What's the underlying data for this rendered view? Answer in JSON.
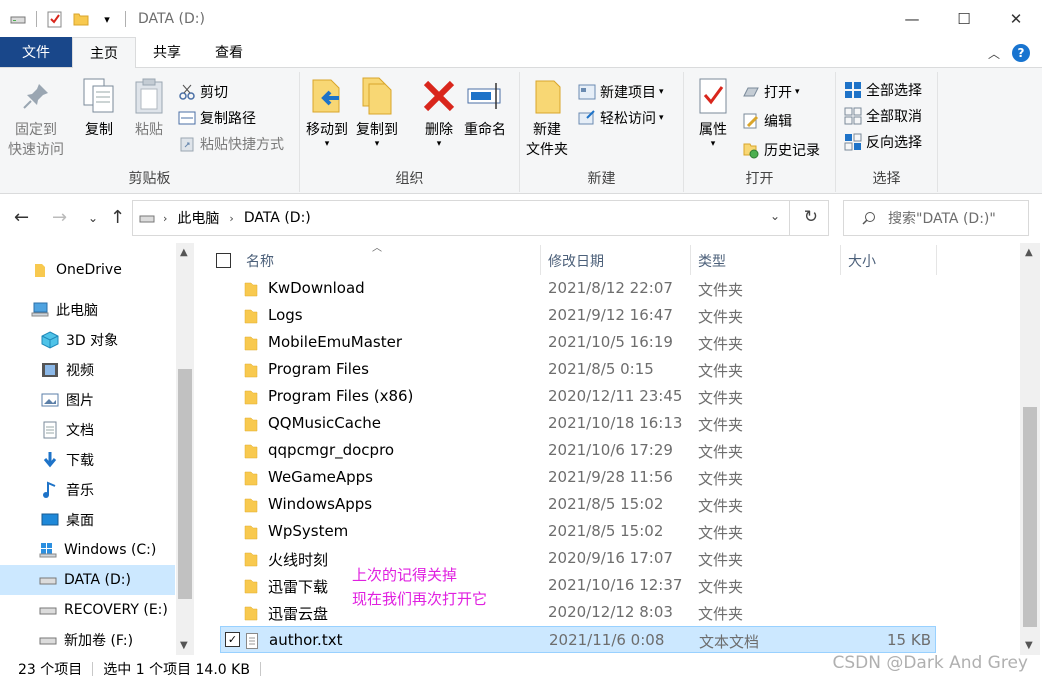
{
  "window": {
    "title": "DATA (D:)",
    "minimize": "—",
    "maximize": "☐",
    "close": "✕"
  },
  "ribbon_tabs": {
    "file": "文件",
    "home": "主页",
    "share": "共享",
    "view": "查看"
  },
  "ribbon": {
    "clipboard": {
      "label": "剪贴板",
      "pin_line1": "固定到",
      "pin_line2": "快速访问",
      "copy": "复制",
      "paste": "粘贴",
      "cut": "剪切",
      "copy_path": "复制路径",
      "paste_shortcut": "粘贴快捷方式"
    },
    "organize": {
      "label": "组织",
      "move_to": "移动到",
      "copy_to": "复制到",
      "delete": "删除",
      "rename": "重命名"
    },
    "new": {
      "label": "新建",
      "new_folder_line1": "新建",
      "new_folder_line2": "文件夹",
      "new_item": "新建项目",
      "easy_access": "轻松访问"
    },
    "open": {
      "label": "打开",
      "properties": "属性",
      "open": "打开",
      "edit": "编辑",
      "history": "历史记录"
    },
    "select": {
      "label": "选择",
      "select_all": "全部选择",
      "select_none": "全部取消",
      "invert": "反向选择"
    }
  },
  "address": {
    "crumb1": "此电脑",
    "crumb2": "DATA (D:)",
    "search_placeholder": "搜索\"DATA (D:)\""
  },
  "nav": {
    "items": [
      {
        "label": "OneDrive",
        "icon": "folder-icon"
      },
      {
        "label": "此电脑",
        "icon": "computer-icon"
      },
      {
        "label": "3D 对象",
        "icon": "cube-icon"
      },
      {
        "label": "视频",
        "icon": "video-icon"
      },
      {
        "label": "图片",
        "icon": "picture-icon"
      },
      {
        "label": "文档",
        "icon": "document-icon"
      },
      {
        "label": "下载",
        "icon": "download-icon"
      },
      {
        "label": "音乐",
        "icon": "music-icon"
      },
      {
        "label": "桌面",
        "icon": "desktop-icon"
      },
      {
        "label": "Windows (C:)",
        "icon": "windows-drive-icon"
      },
      {
        "label": "DATA (D:)",
        "icon": "drive-icon"
      },
      {
        "label": "RECOVERY (E:)",
        "icon": "drive-icon"
      },
      {
        "label": "新加卷 (F:)",
        "icon": "drive-icon"
      }
    ]
  },
  "columns": {
    "name": "名称",
    "date": "修改日期",
    "type": "类型",
    "size": "大小"
  },
  "files": [
    {
      "name": "KwDownload",
      "date": "2021/8/12 22:07",
      "type": "文件夹",
      "size": ""
    },
    {
      "name": "Logs",
      "date": "2021/9/12 16:47",
      "type": "文件夹",
      "size": ""
    },
    {
      "name": "MobileEmuMaster",
      "date": "2021/10/5 16:19",
      "type": "文件夹",
      "size": ""
    },
    {
      "name": "Program Files",
      "date": "2021/8/5 0:15",
      "type": "文件夹",
      "size": ""
    },
    {
      "name": "Program Files (x86)",
      "date": "2020/12/11 23:45",
      "type": "文件夹",
      "size": ""
    },
    {
      "name": "QQMusicCache",
      "date": "2021/10/18 16:13",
      "type": "文件夹",
      "size": ""
    },
    {
      "name": "qqpcmgr_docpro",
      "date": "2021/10/6 17:29",
      "type": "文件夹",
      "size": ""
    },
    {
      "name": "WeGameApps",
      "date": "2021/9/28 11:56",
      "type": "文件夹",
      "size": ""
    },
    {
      "name": "WindowsApps",
      "date": "2021/8/5 15:02",
      "type": "文件夹",
      "size": ""
    },
    {
      "name": "WpSystem",
      "date": "2021/8/5 15:02",
      "type": "文件夹",
      "size": ""
    },
    {
      "name": "火线时刻",
      "date": "2020/9/16 17:07",
      "type": "文件夹",
      "size": ""
    },
    {
      "name": "迅雷下载",
      "date": "2021/10/16 12:37",
      "type": "文件夹",
      "size": ""
    },
    {
      "name": "迅雷云盘",
      "date": "2020/12/12 8:03",
      "type": "文件夹",
      "size": ""
    },
    {
      "name": "author.txt",
      "date": "2021/11/6 0:08",
      "type": "文本文档",
      "size": "15 KB"
    }
  ],
  "annotation": {
    "line1": "上次的记得关掉",
    "line2": "现在我们再次打开它"
  },
  "status": {
    "count": "23 个项目",
    "selection": "选中 1 个项目 14.0 KB"
  },
  "watermark": "CSDN @Dark And Grey",
  "colors": {
    "file_tab": "#19478a",
    "selection": "#cce8ff",
    "annotation": "#e020e0",
    "folder": "#f8c94f"
  }
}
